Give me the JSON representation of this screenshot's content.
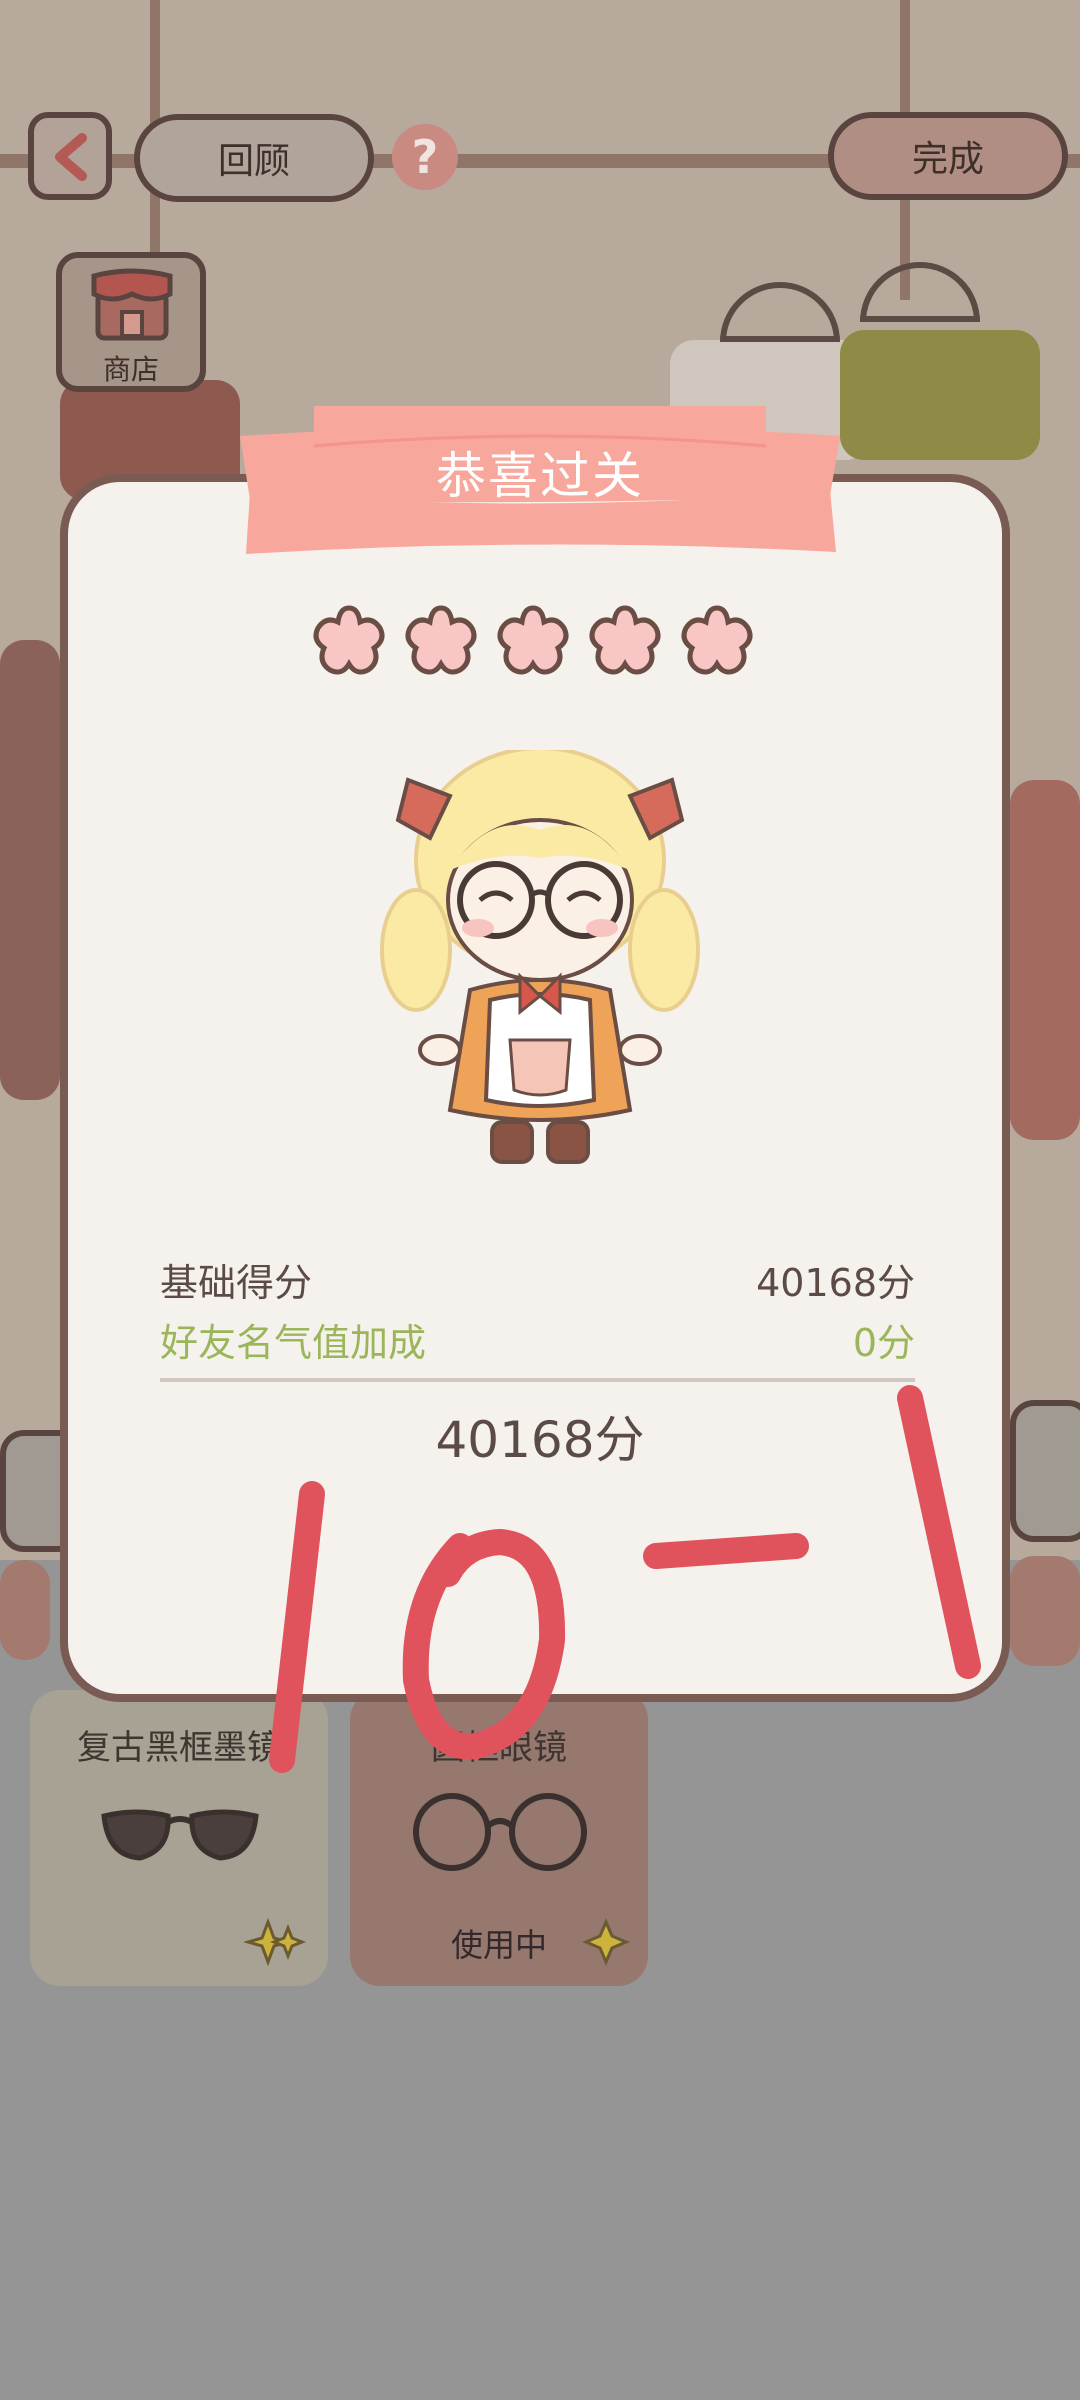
{
  "top_bar": {
    "review_label": "回顾",
    "help_symbol": "?",
    "done_label": "完成",
    "back_icon": "chevron-left-icon"
  },
  "shop": {
    "label": "商店",
    "icon": "shop-icon"
  },
  "items": [
    {
      "name": "复古黑框墨镜",
      "icon": "sunglasses-icon",
      "status": ""
    },
    {
      "name": "圆框眼镜",
      "icon": "round-glasses-icon",
      "status": "使用中"
    }
  ],
  "result": {
    "title": "恭喜过关",
    "stars_earned": 5,
    "stars_total": 5,
    "base_score_label": "基础得分",
    "base_score_value": "40168分",
    "bonus_label": "好友名气值加成",
    "bonus_value": "0分",
    "total": "40168分"
  },
  "handwritten_note": "10-1",
  "colors": {
    "ribbon": "#f8a79c",
    "star": "#f8c6c4",
    "bonus_text": "#9bb55a",
    "annotation_red": "#e0535c",
    "modal_bg": "#f5f2ed"
  }
}
